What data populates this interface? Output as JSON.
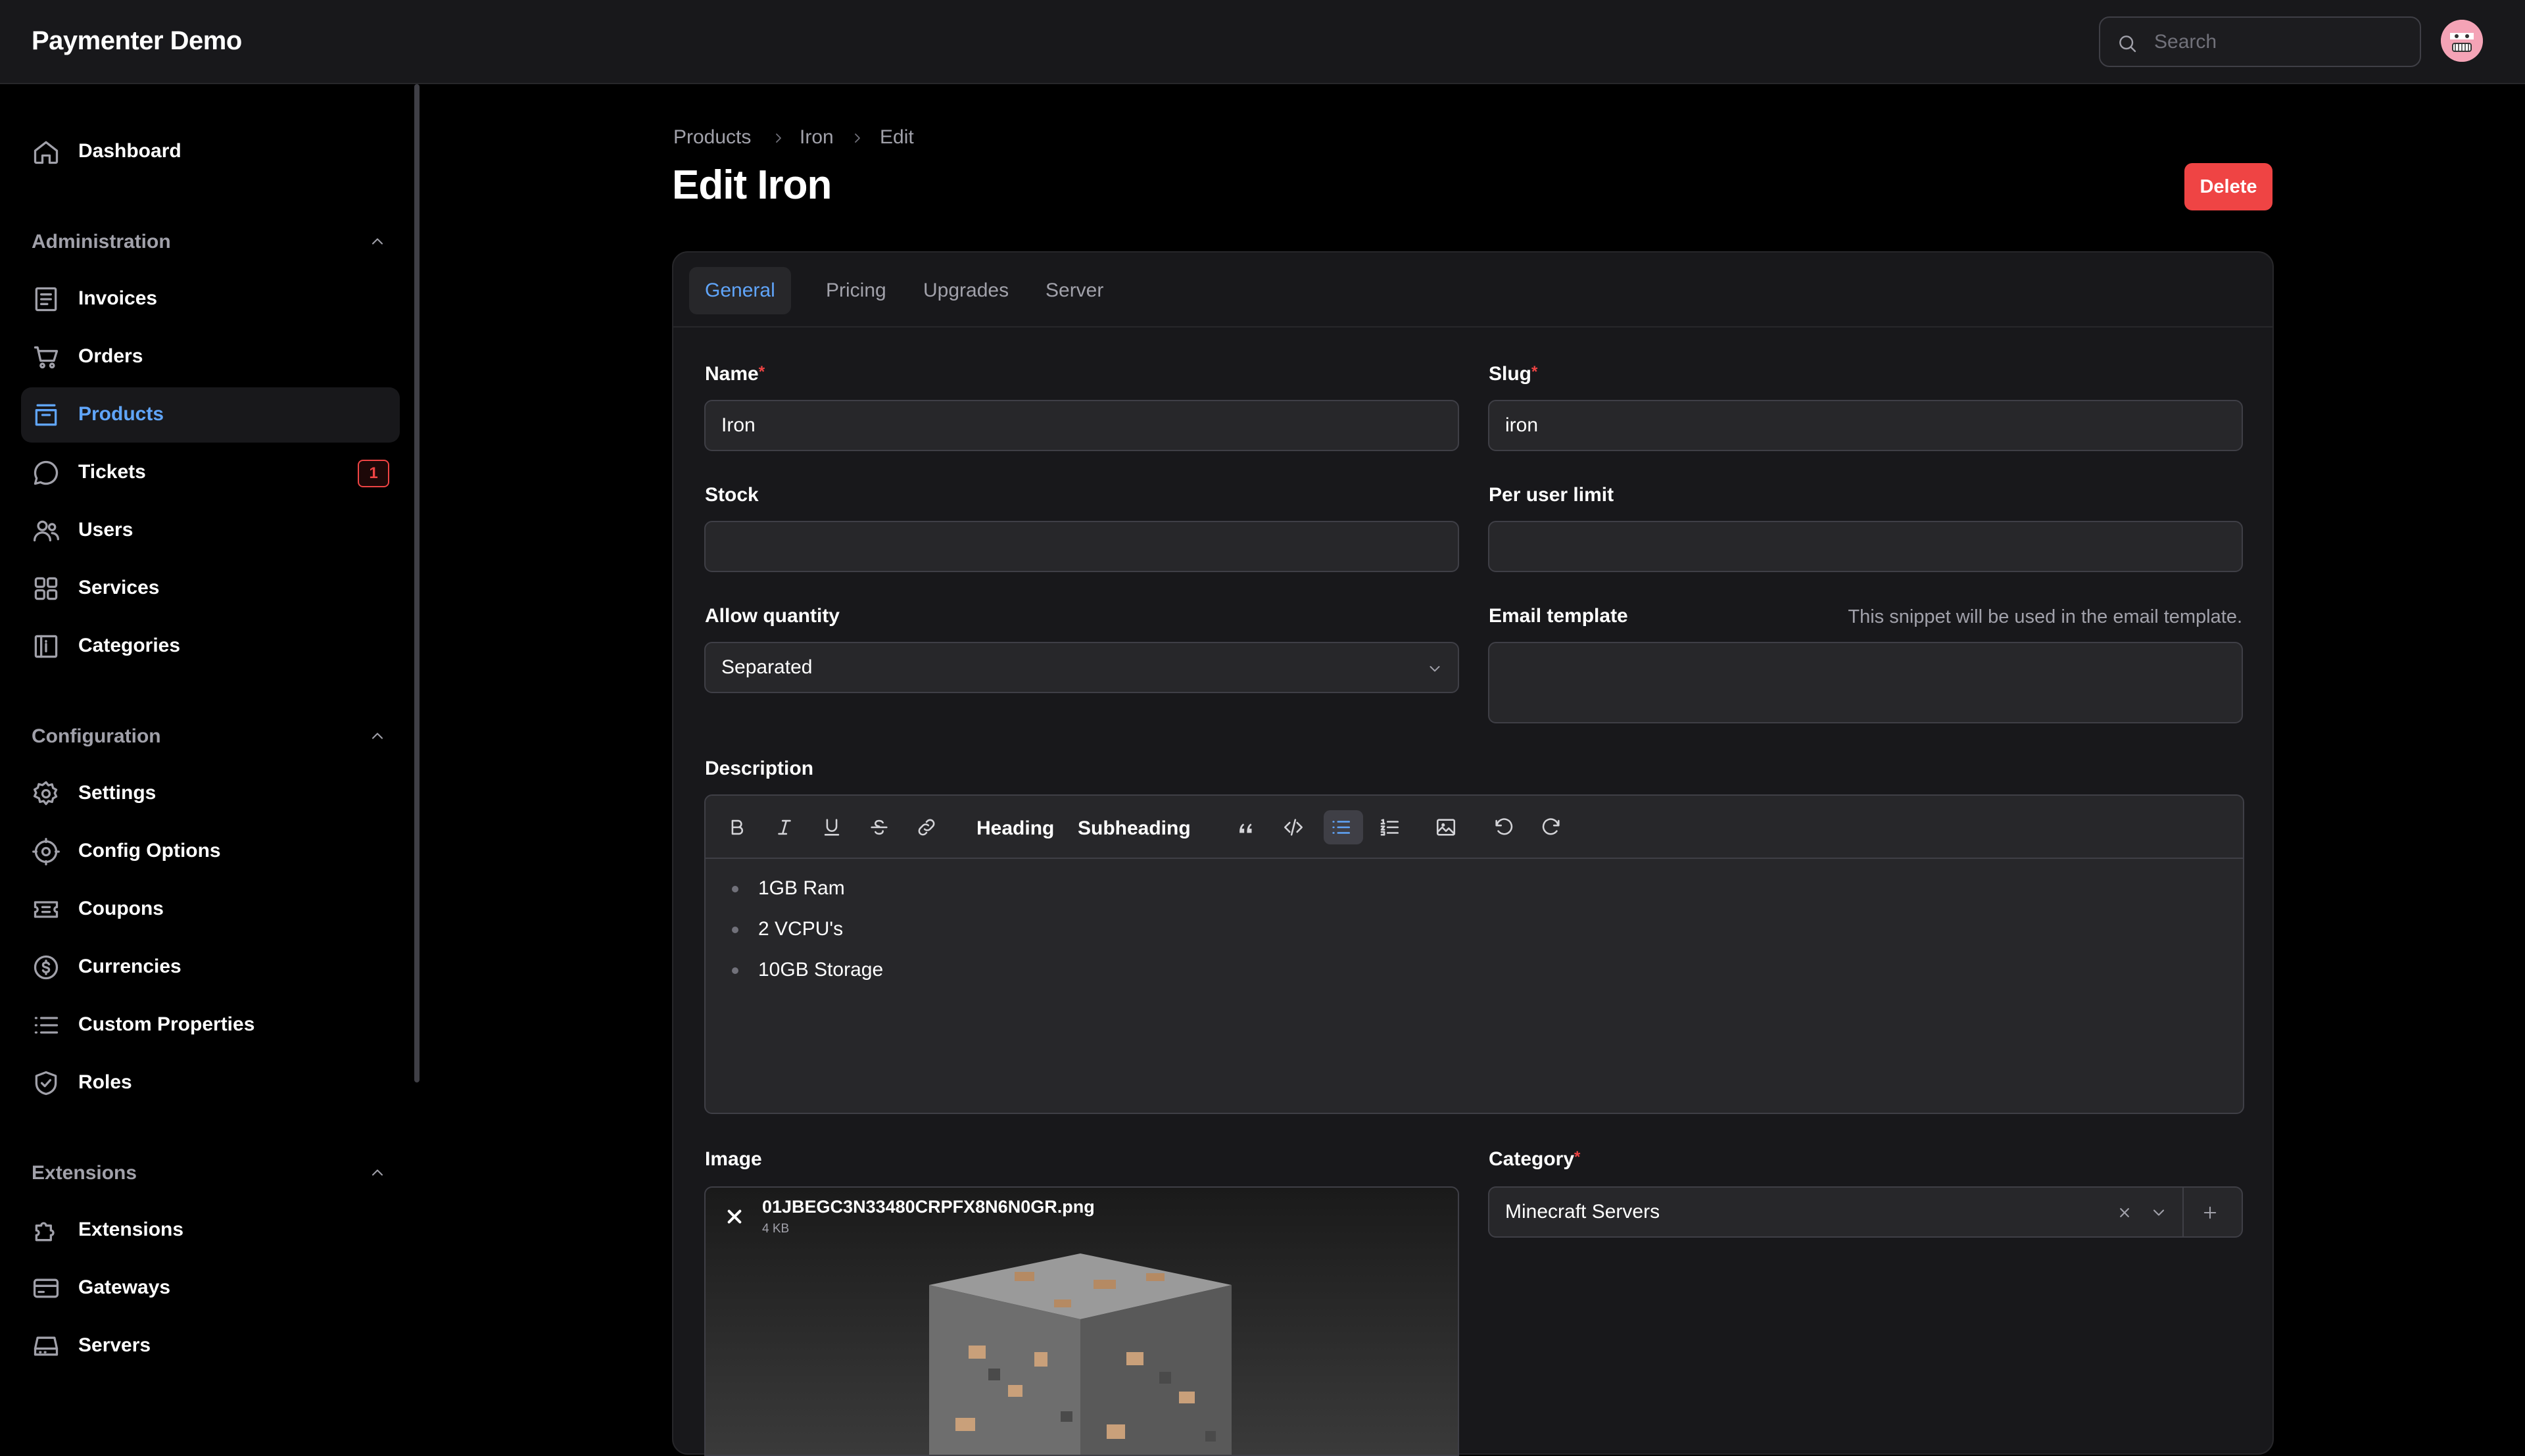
{
  "app": {
    "title": "Paymenter Demo"
  },
  "search": {
    "placeholder": "Search"
  },
  "sidebar": {
    "dashboard": "Dashboard",
    "groups": {
      "administration": "Administration",
      "configuration": "Configuration",
      "extensions": "Extensions"
    },
    "administration_items": [
      "Invoices",
      "Orders",
      "Products",
      "Tickets",
      "Users",
      "Services",
      "Categories"
    ],
    "tickets_badge": "1",
    "configuration_items": [
      "Settings",
      "Config Options",
      "Coupons",
      "Currencies",
      "Custom Properties",
      "Roles"
    ],
    "extensions_items": [
      "Extensions",
      "Gateways",
      "Servers"
    ],
    "active_item": "Products"
  },
  "breadcrumb": [
    "Products",
    "Iron",
    "Edit"
  ],
  "page": {
    "title": "Edit Iron",
    "delete_label": "Delete"
  },
  "tabs": [
    "General",
    "Pricing",
    "Upgrades",
    "Server"
  ],
  "active_tab": "General",
  "form": {
    "name": {
      "label": "Name",
      "required_mark": "*",
      "value": "Iron"
    },
    "slug": {
      "label": "Slug",
      "required_mark": "*",
      "value": "iron"
    },
    "stock": {
      "label": "Stock",
      "value": ""
    },
    "per_user_limit": {
      "label": "Per user limit",
      "value": ""
    },
    "allow_quantity": {
      "label": "Allow quantity",
      "value": "Separated"
    },
    "email_template": {
      "label": "Email template",
      "hint": "This snippet will be used in the email template.",
      "value": ""
    },
    "description": {
      "label": "Description",
      "toolbar_text": [
        "Heading",
        "Subheading"
      ],
      "items": [
        "1GB Ram",
        "2 VCPU's",
        "10GB Storage"
      ]
    },
    "image": {
      "label": "Image",
      "file_name": "01JBEGC3N33480CRPFX8N6N0GR.png",
      "file_size": "4 KB"
    },
    "category": {
      "label": "Category",
      "required_mark": "*",
      "value": "Minecraft Servers"
    }
  },
  "colors": {
    "accent": "#60a5fa",
    "danger": "#ef4444",
    "background": "#000000",
    "surface": "#18181b"
  }
}
